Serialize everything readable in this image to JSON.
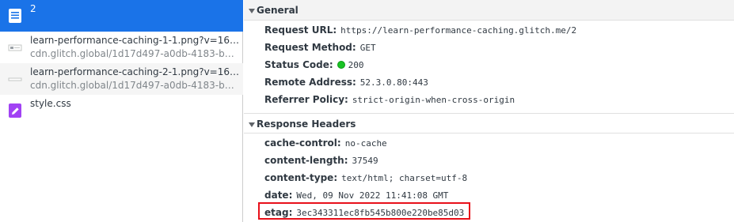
{
  "requests": [
    {
      "name": "2",
      "sub": "",
      "icon": "document-icon"
    },
    {
      "name": "learn-performance-caching-1-1.png?v=166799...",
      "sub": "cdn.glitch.global/1d17d497-a0db-4183-b4e9-1...",
      "icon": "image-icon"
    },
    {
      "name": "learn-performance-caching-2-1.png?v=166799...",
      "sub": "cdn.glitch.global/1d17d497-a0db-4183-b4e9-1...",
      "icon": "image-icon"
    },
    {
      "name": "style.css",
      "sub": "",
      "icon": "stylesheet-icon"
    }
  ],
  "general": {
    "title": "General",
    "rows": [
      {
        "key": "Request URL:",
        "value": "https://learn-performance-caching.glitch.me/2"
      },
      {
        "key": "Request Method:",
        "value": "GET"
      },
      {
        "key": "Status Code:",
        "value": "200"
      },
      {
        "key": "Remote Address:",
        "value": "52.3.0.80:443"
      },
      {
        "key": "Referrer Policy:",
        "value": "strict-origin-when-cross-origin"
      }
    ]
  },
  "response_headers": {
    "title": "Response Headers",
    "rows": [
      {
        "key": "cache-control:",
        "value": "no-cache"
      },
      {
        "key": "content-length:",
        "value": "37549"
      },
      {
        "key": "content-type:",
        "value": "text/html; charset=utf-8"
      },
      {
        "key": "date:",
        "value": "Wed, 09 Nov 2022 11:41:08 GMT"
      },
      {
        "key": "etag:",
        "value": "3ec343311ec8fb545b800e220be85d03"
      }
    ]
  },
  "colors": {
    "selected": "#1a73e8",
    "status_ok": "#19c324",
    "highlight": "#e8101a"
  }
}
